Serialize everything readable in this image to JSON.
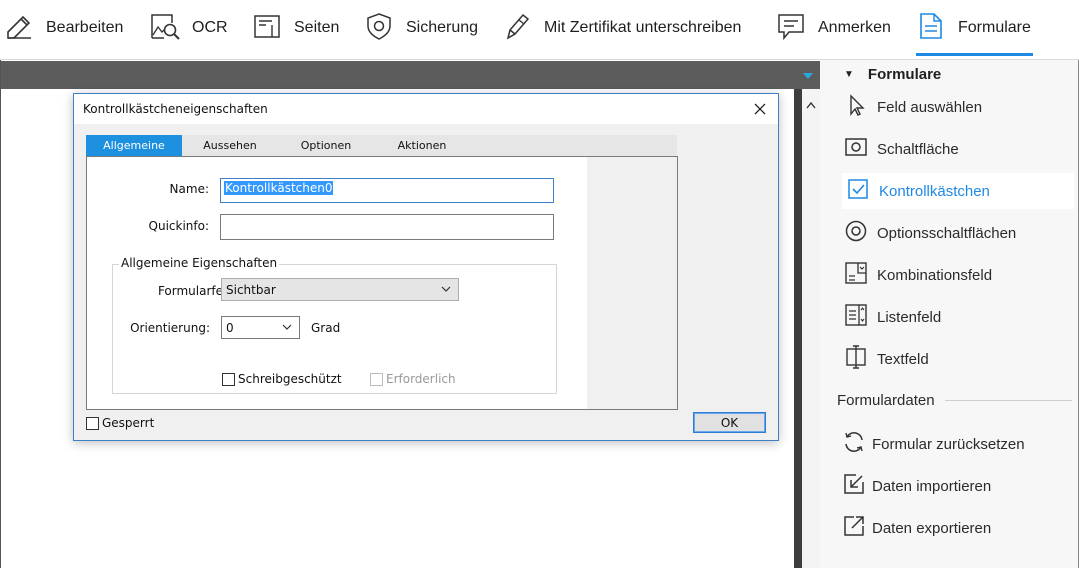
{
  "toolbar": {
    "items": [
      {
        "label": "Bearbeiten",
        "icon": "pencil-icon"
      },
      {
        "label": "OCR",
        "icon": "ocr-scan-icon"
      },
      {
        "label": "Seiten",
        "icon": "pages-icon"
      },
      {
        "label": "Sicherung",
        "icon": "shield-icon"
      },
      {
        "label": "Mit Zertifikat unterschreiben",
        "icon": "pen-sign-icon"
      },
      {
        "label": "Anmerken",
        "icon": "comment-icon"
      },
      {
        "label": "Formulare",
        "icon": "form-document-icon",
        "active": true
      }
    ],
    "accent": "#1e88e5"
  },
  "right_panel": {
    "header": "Formulare",
    "items": [
      {
        "label": "Feld auswählen",
        "icon": "cursor-arrow-icon"
      },
      {
        "label": "Schaltfläche",
        "icon": "button-field-icon"
      },
      {
        "label": "Kontrollkästchen",
        "icon": "checkbox-field-icon",
        "selected": true
      },
      {
        "label": "Optionsschaltflächen",
        "icon": "radio-button-icon"
      },
      {
        "label": "Kombinationsfeld",
        "icon": "combo-box-icon"
      },
      {
        "label": "Listenfeld",
        "icon": "list-box-icon"
      },
      {
        "label": "Textfeld",
        "icon": "text-field-icon"
      }
    ],
    "data_section": "Formulardaten",
    "data_items": [
      {
        "label": "Formular zurücksetzen",
        "icon": "reset-icon"
      },
      {
        "label": "Daten importieren",
        "icon": "import-icon"
      },
      {
        "label": "Daten exportieren",
        "icon": "export-icon"
      }
    ]
  },
  "dialog": {
    "title": "Kontrollkästcheneigenschaften",
    "tabs": [
      "Allgemeine",
      "Aussehen",
      "Optionen",
      "Aktionen"
    ],
    "active_tab": "Allgemeine",
    "name_label": "Name:",
    "name_value": "Kontrollkästchen0",
    "tooltip_label": "Quickinfo:",
    "tooltip_value": "",
    "group_title": "Allgemeine Eigenschaften",
    "form_field_label": "Formularfeld:",
    "form_field_value": "Sichtbar",
    "orientation_label": "Orientierung:",
    "orientation_value": "0",
    "orientation_unit": "Grad",
    "readonly_label": "Schreibgeschützt",
    "required_label": "Erforderlich",
    "locked_label": "Gesperrt",
    "ok_label": "OK"
  }
}
